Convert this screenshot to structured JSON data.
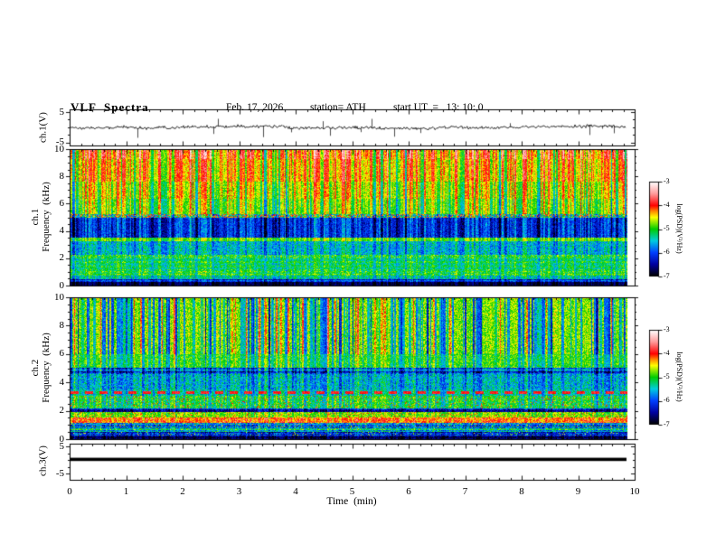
{
  "header": {
    "title": "VLF  Spectra",
    "date": "Feb. 17, 2026",
    "station": "station= ATH",
    "start_ut": "start UT  =   13: 10: 0"
  },
  "chart_data": {
    "type": "heatmap",
    "description": "VLF spectra multipanel plot: ch.1 voltage waveform, ch.1 and ch.2 spectrograms 0-10 kHz, ch.3 voltage trace, versus time 0-10 min",
    "time_axis": {
      "label": "Time  (min)",
      "ticks": [
        "0",
        "1",
        "2",
        "3",
        "4",
        "5",
        "6",
        "7",
        "8",
        "9",
        "10"
      ],
      "range_min": [
        0,
        10
      ],
      "minor_step_min": 0.2,
      "data_end_min": 9.85
    },
    "colorbar": {
      "label": "log(PSD)(V²/Hz)",
      "ticks": [
        "-3",
        "-4",
        "-5",
        "-6",
        "-7"
      ],
      "range": [
        -3,
        -7
      ]
    },
    "colormap_stops": [
      [
        0.0,
        "#000000"
      ],
      [
        0.125,
        "#0000a0"
      ],
      [
        0.25,
        "#0040ff"
      ],
      [
        0.375,
        "#00cce0"
      ],
      [
        0.5,
        "#00cc00"
      ],
      [
        0.625,
        "#ffff00"
      ],
      [
        0.69,
        "#ff8800"
      ],
      [
        0.75,
        "#ff0000"
      ],
      [
        0.875,
        "#ff9999"
      ],
      [
        1.0,
        "#ffffff"
      ]
    ],
    "panels": [
      {
        "id": "ch1-wave",
        "type": "line",
        "ylabel": "ch.1(V)",
        "y_ticks": [
          "5",
          "-5"
        ],
        "y_range": [
          -5,
          5
        ],
        "signal": {
          "kind": "noise",
          "seed": 1337,
          "sigma": 0.5,
          "spike_prob": 0.02,
          "spike_max": 4.2,
          "duration_min": 9.85
        }
      },
      {
        "id": "ch1-spec",
        "type": "spectrogram",
        "ylabel_lines": [
          "ch.1",
          "Frequency  (kHz)"
        ],
        "y_ticks": [
          "10",
          "8",
          "6",
          "4",
          "2",
          "0"
        ],
        "y_range_khz": [
          0,
          10
        ],
        "seed": 424242,
        "stripes": {
          "p_bright": 0.45,
          "bright": [
            0.25,
            0.8
          ],
          "p_dark": 0.1,
          "dark": [
            0.3,
            0.7
          ],
          "col_jitter": 0.22,
          "zones": [
            [
              9.3,
              10.01,
              1.25
            ],
            [
              5.3,
              9.3,
              1.0
            ],
            [
              3.55,
              5.3,
              0.8
            ],
            [
              2.3,
              3.55,
              0.55
            ],
            [
              0,
              2.3,
              0.4
            ]
          ]
        },
        "bands": [
          {
            "f": [
              9.3,
              10.01
            ],
            "v": -4.4,
            "j": 0.3
          },
          {
            "f": [
              7.7,
              9.3
            ],
            "v": -4.55,
            "j": 0.3
          },
          {
            "f": [
              6.4,
              7.7
            ],
            "v": -4.8,
            "j": 0.3
          },
          {
            "f": [
              5.3,
              6.4
            ],
            "v": -5.0,
            "j": 0.3
          },
          {
            "f": [
              5.0,
              5.3
            ],
            "v": -5.6,
            "j": 0.55,
            "speckle": {
              "p": 0.3,
              "v": -4.2
            }
          },
          {
            "f": [
              3.55,
              5.0
            ],
            "v": -6.3,
            "j": 0.35
          },
          {
            "f": [
              3.3,
              3.55
            ],
            "v": -4.95,
            "j": 0.3
          },
          {
            "f": [
              2.3,
              3.3
            ],
            "v": -5.65,
            "j": 0.4
          },
          {
            "f": [
              2.0,
              2.3
            ],
            "v": -5.2,
            "j": 0.4,
            "speckle": {
              "p": 0.12,
              "v": -4.6
            }
          },
          {
            "f": [
              1.1,
              2.0
            ],
            "v": -5.25,
            "j": 0.35,
            "row": 0.15
          },
          {
            "f": [
              0.75,
              1.1
            ],
            "v": -5.05,
            "j": 0.4,
            "row": 0.25
          },
          {
            "f": [
              0.5,
              0.75
            ],
            "v": -5.6,
            "j": 0.45,
            "row": 0.35
          },
          {
            "f": [
              0.28,
              0.5
            ],
            "v": -6.2,
            "j": 0.35,
            "row": 0.3
          },
          {
            "f": [
              0,
              0.28
            ],
            "v": -6.85,
            "j": 0.15
          }
        ]
      },
      {
        "id": "ch2-spec",
        "type": "spectrogram",
        "ylabel_lines": [
          "ch.2",
          "Frequency  (kHz)"
        ],
        "y_ticks": [
          "10",
          "8",
          "6",
          "4",
          "2",
          "0"
        ],
        "y_range_khz": [
          0,
          10
        ],
        "seed": 777001,
        "stripes": {
          "p_bright": 0.06,
          "bright": [
            0.5,
            0.9
          ],
          "p_dark": 0.3,
          "dark": [
            0.5,
            1.5
          ],
          "col_jitter": 0.15,
          "zones": [
            [
              6.0,
              10.01,
              1.0
            ],
            [
              4.6,
              6.0,
              0.55
            ],
            [
              2.2,
              4.6,
              0.4
            ],
            [
              0,
              2.2,
              0.25
            ]
          ]
        },
        "bands": [
          {
            "f": [
              6.0,
              10.01
            ],
            "v": -4.75,
            "j": 0.35
          },
          {
            "f": [
              5.05,
              6.0
            ],
            "v": -4.9,
            "j": 0.35
          },
          {
            "f": [
              4.6,
              5.05
            ],
            "v": -5.9,
            "j": 0.45,
            "row": 0.4
          },
          {
            "f": [
              3.5,
              4.6
            ],
            "v": -5.45,
            "j": 0.45
          },
          {
            "f": [
              3.1,
              3.5
            ],
            "v": -5.3,
            "j": 0.4,
            "dash": {
              "v": -3.9,
              "on": 9,
              "off": 7,
              "fc": 3.3,
              "hw": 0.1
            }
          },
          {
            "f": [
              2.2,
              3.1
            ],
            "v": -5.0,
            "j": 0.4,
            "speckle": {
              "p": 0.07,
              "v": -4.15
            }
          },
          {
            "f": [
              1.95,
              2.2
            ],
            "v": -6.15,
            "j": 0.4,
            "row": 0.35
          },
          {
            "f": [
              1.55,
              1.95
            ],
            "v": -4.7,
            "j": 0.35,
            "speckle": {
              "p": 0.1,
              "v": -4.1
            }
          },
          {
            "f": [
              1.15,
              1.55
            ],
            "v": -4.1,
            "j": 0.35,
            "speckle": {
              "p": 0.12,
              "v": -3.6
            }
          },
          {
            "f": [
              0.85,
              1.15
            ],
            "v": -5.8,
            "j": 0.5,
            "row": 0.45,
            "speckle": {
              "p": 0.05,
              "v": -4.4
            }
          },
          {
            "f": [
              0.5,
              0.85
            ],
            "v": -5.45,
            "j": 0.5,
            "row": 0.5
          },
          {
            "f": [
              0.28,
              0.5
            ],
            "v": -6.1,
            "j": 0.45,
            "row": 0.4,
            "speckle": {
              "p": 0.05,
              "v": -4.6
            }
          },
          {
            "f": [
              0,
              0.28
            ],
            "v": -6.8,
            "j": 0.25,
            "row": 0.3
          }
        ]
      },
      {
        "id": "ch3-wave",
        "type": "line",
        "ylabel": "ch.3(V)",
        "y_ticks": [
          "5",
          "-5"
        ],
        "y_range": [
          -5,
          5
        ],
        "signal": {
          "kind": "constant",
          "value": 0.2,
          "duration_min": 9.85
        }
      }
    ]
  }
}
